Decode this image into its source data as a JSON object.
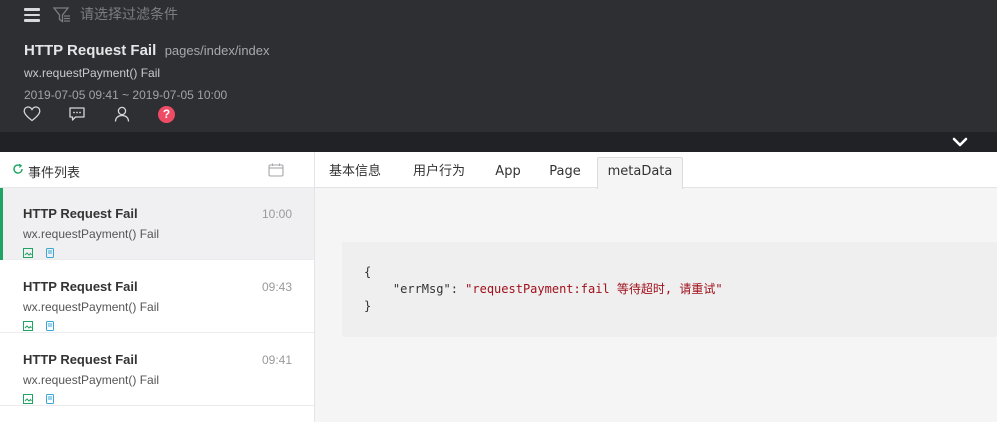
{
  "filter": {
    "placeholder": "请选择过滤条件"
  },
  "event": {
    "title": "HTTP Request Fail",
    "page": "pages/index/index",
    "subtitle": "wx.requestPayment() Fail",
    "time_range": "2019-07-05 09:41 ~ 2019-07-05 10:00",
    "help_label": "?"
  },
  "list": {
    "title": "事件列表",
    "items": [
      {
        "title": "HTTP Request Fail",
        "time": "10:00",
        "subtitle": "wx.requestPayment() Fail"
      },
      {
        "title": "HTTP Request Fail",
        "time": "09:43",
        "subtitle": "wx.requestPayment() Fail"
      },
      {
        "title": "HTTP Request Fail",
        "time": "09:41",
        "subtitle": "wx.requestPayment() Fail"
      }
    ]
  },
  "tabs": [
    {
      "label": "基本信息"
    },
    {
      "label": "用户行为"
    },
    {
      "label": "App"
    },
    {
      "label": "Page"
    },
    {
      "label": "metaData"
    }
  ],
  "metadata": {
    "open_brace": "{",
    "key": "\"errMsg\"",
    "colon": ": ",
    "value": "\"requestPayment:fail 等待超时, 请重试\"",
    "close_brace": "}"
  },
  "colors": {
    "accent_green": "#1fa463",
    "help_red": "#f04b65",
    "json_string": "#a0101a"
  },
  "icons": [
    "menu-icon",
    "filter-icon",
    "heart-icon",
    "comment-icon",
    "user-icon",
    "chevron-down-icon",
    "refresh-icon",
    "calendar-icon",
    "image-icon",
    "device-icon"
  ]
}
